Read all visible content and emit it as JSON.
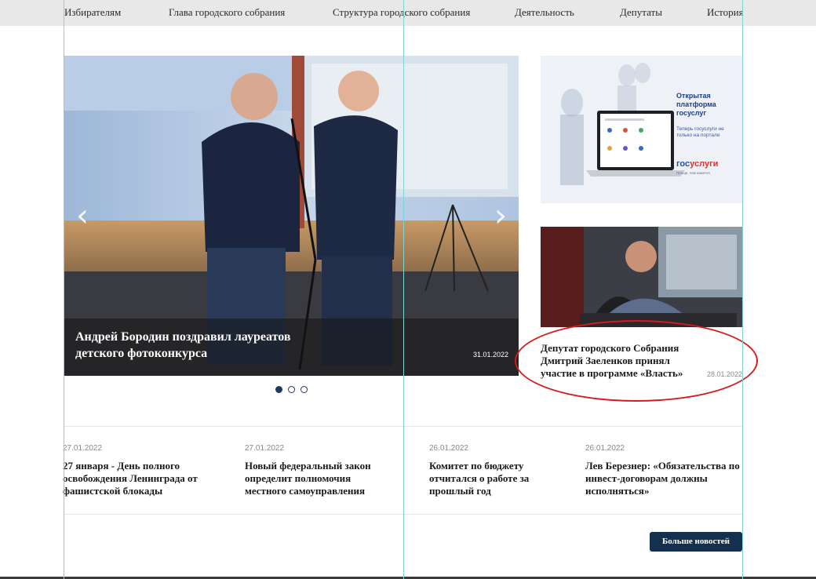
{
  "nav": {
    "items": [
      {
        "label": "Избирателям"
      },
      {
        "label": "Глава городского собрания"
      },
      {
        "label": "Структура городского собрания"
      },
      {
        "label": "Деятельность"
      },
      {
        "label": "Депутаты"
      },
      {
        "label": "История"
      }
    ]
  },
  "slider": {
    "title": "Андрей Бородин поздравил лауреатов детского фотоконкурса",
    "date": "31.01.2022",
    "prev_icon": "chevron-left-icon",
    "next_icon": "chevron-right-icon",
    "dots": 3,
    "active_dot": 0
  },
  "banner": {
    "title": "Открытая платформа госуслуг",
    "subtitle": "Теперь госуслуги не только на портале",
    "brand_a": "гос",
    "brand_b": "услуги",
    "tagline": "Проще, чем кажется"
  },
  "side_news": {
    "title": "Депутат городского Собрания Дмитрий Заеленков принял участие в программе «Власть»",
    "date": "28.01.2022"
  },
  "news": [
    {
      "date": "27.01.2022",
      "title": "27 января - День полного освобождения Ленинграда от фашистской блокады"
    },
    {
      "date": "27.01.2022",
      "title": "Новый федеральный закон определит полномочия местного самоуправления"
    },
    {
      "date": "26.01.2022",
      "title": "Комитет по бюджету отчитался о работе за прошлый год"
    },
    {
      "date": "26.01.2022",
      "title": "Лев Березнер: «Обязательства по инвест-договорам должны исполняться»"
    }
  ],
  "more_button": "Больше новостей",
  "colors": {
    "nav_bg": "#e8e8e8",
    "accent": "#15304f",
    "highlight": "#d71a1a",
    "guide": "#7fd6d6"
  }
}
